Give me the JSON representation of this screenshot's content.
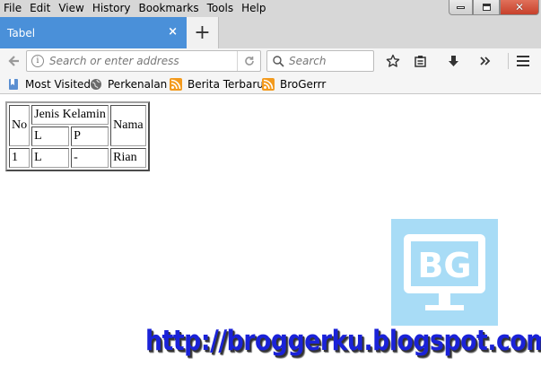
{
  "menu": {
    "items": [
      "File",
      "Edit",
      "View",
      "History",
      "Bookmarks",
      "Tools",
      "Help"
    ]
  },
  "tab": {
    "title": "Tabel",
    "close": "×",
    "new_tab": "+"
  },
  "navbar": {
    "address_placeholder": "Search or enter address",
    "search_placeholder": "Search"
  },
  "bookmarks": [
    "Most Visited",
    "Perkenalan",
    "Berita Terbaru",
    "BroGerrr"
  ],
  "table": {
    "header": {
      "no": "No",
      "jenis_kelamin": "Jenis Kelamin",
      "nama": "Nama",
      "l": "L",
      "p": "P"
    },
    "row": {
      "no": "1",
      "l": "L",
      "p": "-",
      "nama": "Rian"
    }
  },
  "watermark": {
    "logo_text": "BG",
    "url": "http://broggerku.blogspot.com"
  },
  "colors": {
    "tab_active": "#4a90d9",
    "chrome": "#d7d7d7",
    "watermark_blue": "#1a22d8",
    "logo_bg": "#a8dcf6"
  }
}
